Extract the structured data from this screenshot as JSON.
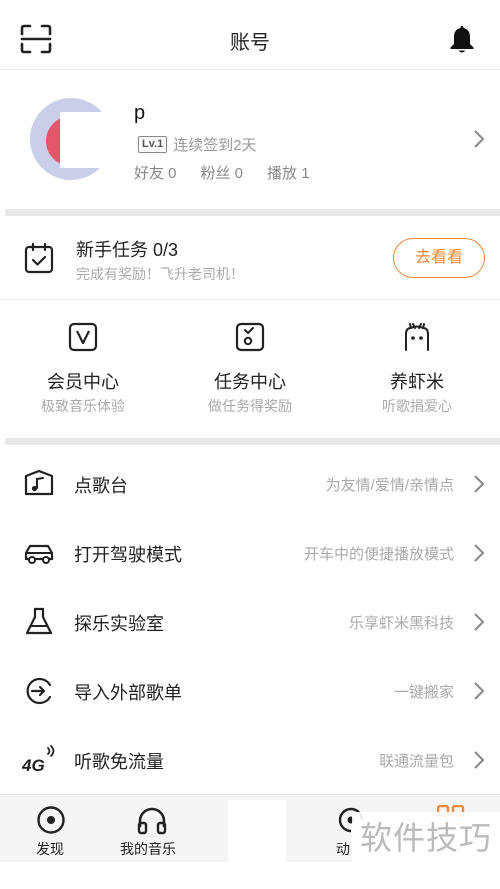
{
  "header": {
    "title": "账号",
    "scan_icon": "scan-icon",
    "bell_icon": "bell-icon"
  },
  "profile": {
    "username": "p",
    "level_badge": "Lv.1",
    "checkin_text": "连续签到2天",
    "friends": "好友 0",
    "fans": "粉丝 0",
    "plays": "播放 1"
  },
  "task": {
    "title": "新手任务 0/3",
    "subtitle": "完成有奖励！飞升老司机！",
    "button": "去看看"
  },
  "grid": [
    {
      "title": "会员中心",
      "subtitle": "极致音乐体验",
      "icon": "vip-icon"
    },
    {
      "title": "任务中心",
      "subtitle": "做任务得奖励",
      "icon": "task-icon"
    },
    {
      "title": "养虾米",
      "subtitle": "听歌捐爱心",
      "icon": "shrimp-icon"
    }
  ],
  "menu": [
    {
      "label": "点歌台",
      "hint": "为友情/爱情/亲情点",
      "icon": "music-box-icon"
    },
    {
      "label": "打开驾驶模式",
      "hint": "开车中的便捷播放模式",
      "icon": "car-icon"
    },
    {
      "label": "探乐实验室",
      "hint": "乐享虾米黑科技",
      "icon": "flask-icon"
    },
    {
      "label": "导入外部歌单",
      "hint": "一键搬家",
      "icon": "import-icon"
    },
    {
      "label": "听歌免流量",
      "hint": "联通流量包",
      "icon": "4g-icon"
    }
  ],
  "tabs": [
    {
      "label": "发现",
      "icon": "discover-icon"
    },
    {
      "label": "我的音乐",
      "icon": "headphones-icon"
    },
    {
      "label": "动",
      "icon": "feed-icon"
    }
  ],
  "watermark": "软件技巧",
  "colors": {
    "accent": "#f08a3a",
    "divider": "#e8e8e8"
  }
}
